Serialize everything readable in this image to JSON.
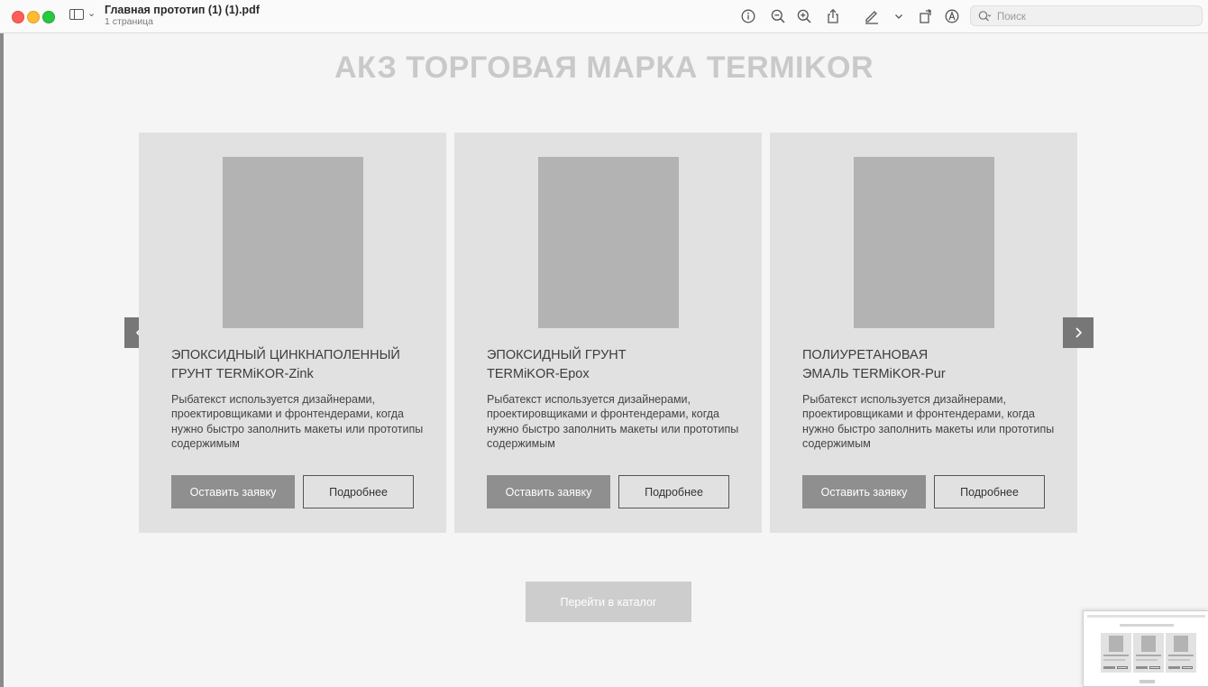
{
  "window": {
    "title": "Главная прототип (1) (1).pdf",
    "subtitle": "1 страница"
  },
  "toolbar": {
    "icons": [
      "info-icon",
      "zoom-out-icon",
      "zoom-in-icon",
      "share-icon",
      "markup-pen-icon",
      "chevron-down-icon",
      "rotate-icon",
      "annotate-icon"
    ],
    "search_placeholder": "Поиск",
    "search_value": ""
  },
  "page": {
    "heading": "АКЗ ТОРГОВАЯ МАРКА TERMIKOR",
    "catalog_button": "Перейти в каталог",
    "cards": [
      {
        "title_line1": "ЭПОКСИДНЫЙ ЦИНКНАПОЛЕННЫЙ",
        "title_line2": "ГРУНТ TERMiKOR-Zink",
        "description": "Рыбатекст используется дизайнерами, проектировщиками и фронтендерами, когда нужно быстро заполнить макеты или прототипы содержимым",
        "primary_button": "Оставить заявку",
        "secondary_button": "Подробнее"
      },
      {
        "title_line1": "ЭПОКСИДНЫЙ ГРУНТ",
        "title_line2": "TERMiKOR-Epox",
        "description": "Рыбатекст используется дизайнерами, проектировщиками и фронтендерами, когда нужно быстро заполнить макеты или прототипы содержимым",
        "primary_button": "Оставить заявку",
        "secondary_button": "Подробнее"
      },
      {
        "title_line1": "ПОЛИУРЕТАНОВАЯ",
        "title_line2": "ЭМАЛЬ TERMiKOR-Pur",
        "description": "Рыбатекст используется дизайнерами, проектировщиками и фронтендерами, когда нужно быстро заполнить макеты или прототипы содержимым",
        "primary_button": "Оставить заявку",
        "secondary_button": "Подробнее"
      }
    ],
    "carousel": {
      "prev_icon": "chevron-left-icon",
      "next_icon": "chevron-right-icon"
    }
  },
  "colors": {
    "heading": "#c9c9c9",
    "card_bg": "#e1e1e1",
    "image_placeholder": "#b3b3b3",
    "primary_button": "#8f8f8f",
    "arrow_bg": "#777777",
    "catalog_button": "#cdcdcd"
  }
}
